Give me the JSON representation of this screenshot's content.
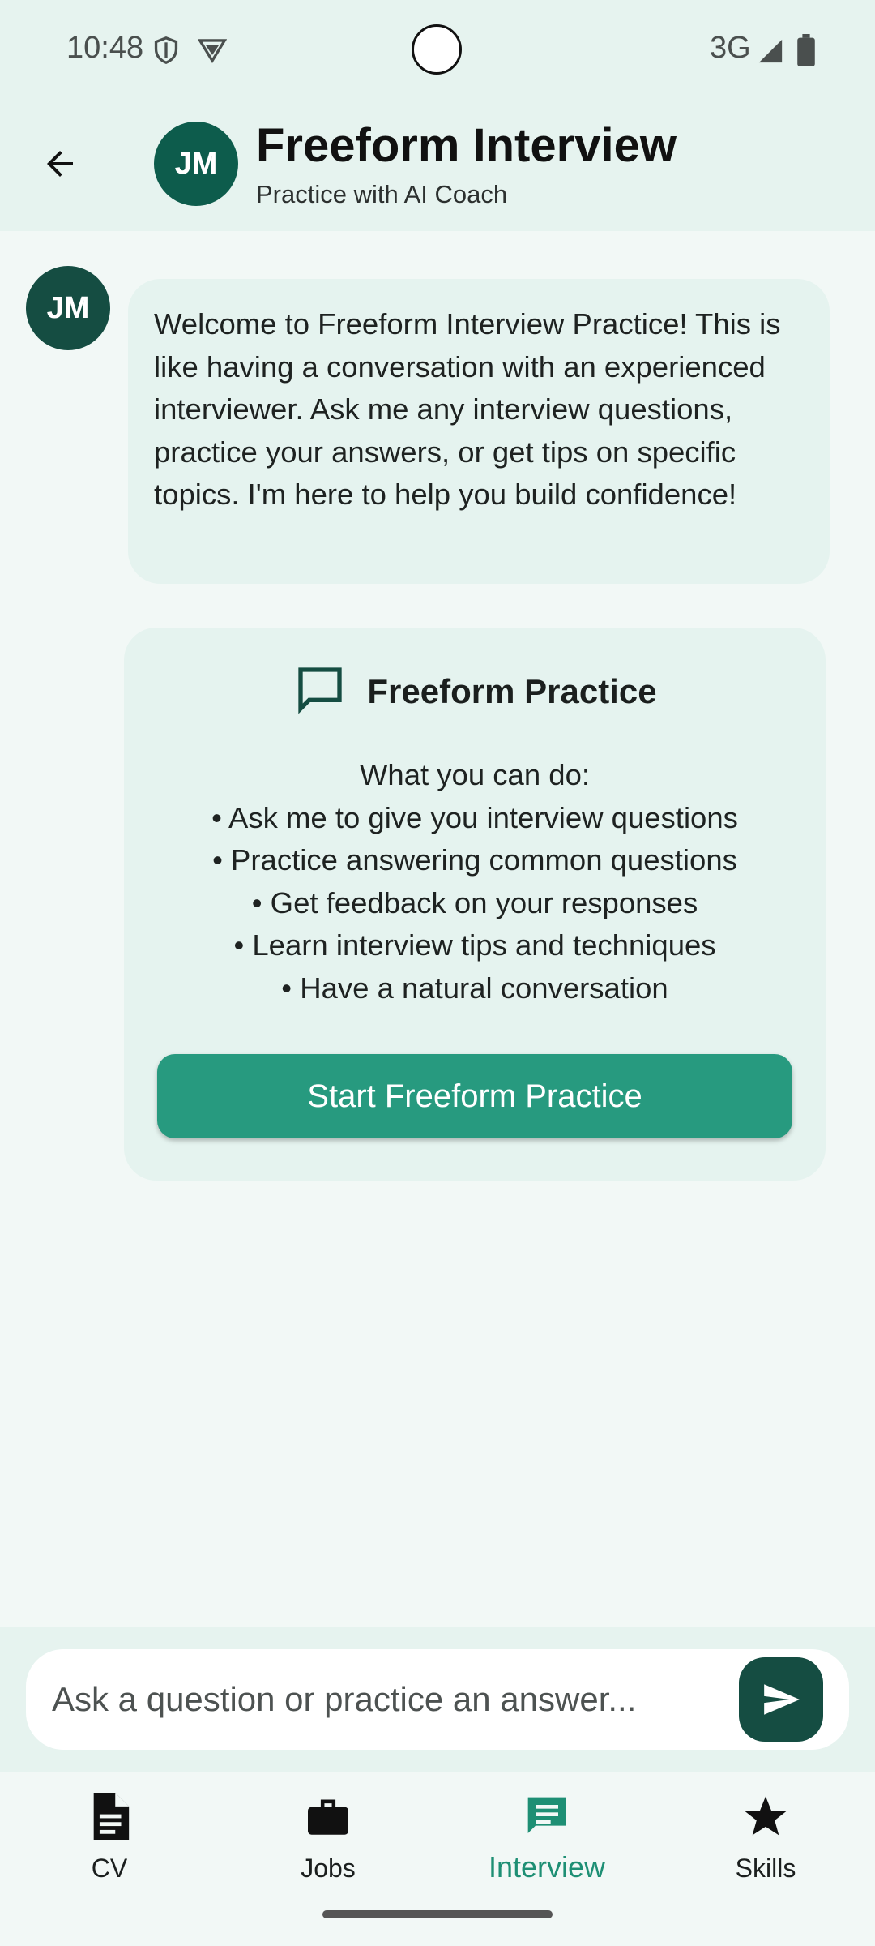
{
  "status_bar": {
    "time": "10:48",
    "network": "3G",
    "icons": [
      "shield-icon",
      "vpn-icon",
      "signal-icon",
      "battery-icon"
    ]
  },
  "header": {
    "avatar_initials": "JM",
    "title": "Freeform Interview",
    "subtitle": "Practice with AI Coach",
    "back_icon": "arrow-back-icon"
  },
  "chat": {
    "avatar_initials": "JM",
    "welcome_message": "Welcome to Freeform Interview Practice! This is like having a conversation with an experienced interviewer. Ask me any interview questions, practice your answers, or get tips on specific topics. I'm here to help you build confidence!",
    "card": {
      "icon": "chat-bubble-icon",
      "title": "Freeform Practice",
      "intro": "What you can do:",
      "items": [
        "• Ask me to give you interview questions",
        "• Practice answering common questions",
        "• Get feedback on your responses",
        "• Learn interview tips and techniques",
        "• Have a natural conversation"
      ],
      "button_label": "Start Freeform Practice"
    }
  },
  "composer": {
    "placeholder": "Ask a question or practice an answer...",
    "value": "",
    "send_icon": "send-icon"
  },
  "bottom_nav": {
    "items": [
      {
        "label": "CV",
        "icon": "document-icon",
        "active": false
      },
      {
        "label": "Jobs",
        "icon": "briefcase-icon",
        "active": false
      },
      {
        "label": "Interview",
        "icon": "chat-icon",
        "active": true
      },
      {
        "label": "Skills",
        "icon": "star-icon",
        "active": false
      }
    ]
  },
  "colors": {
    "accent": "#279a7f",
    "accent_dark": "#154d42",
    "active_nav": "#1e8f74",
    "header_bg": "#e6f3ef",
    "page_bg": "#f2f8f6",
    "bubble_bg": "#e5f3ef"
  }
}
